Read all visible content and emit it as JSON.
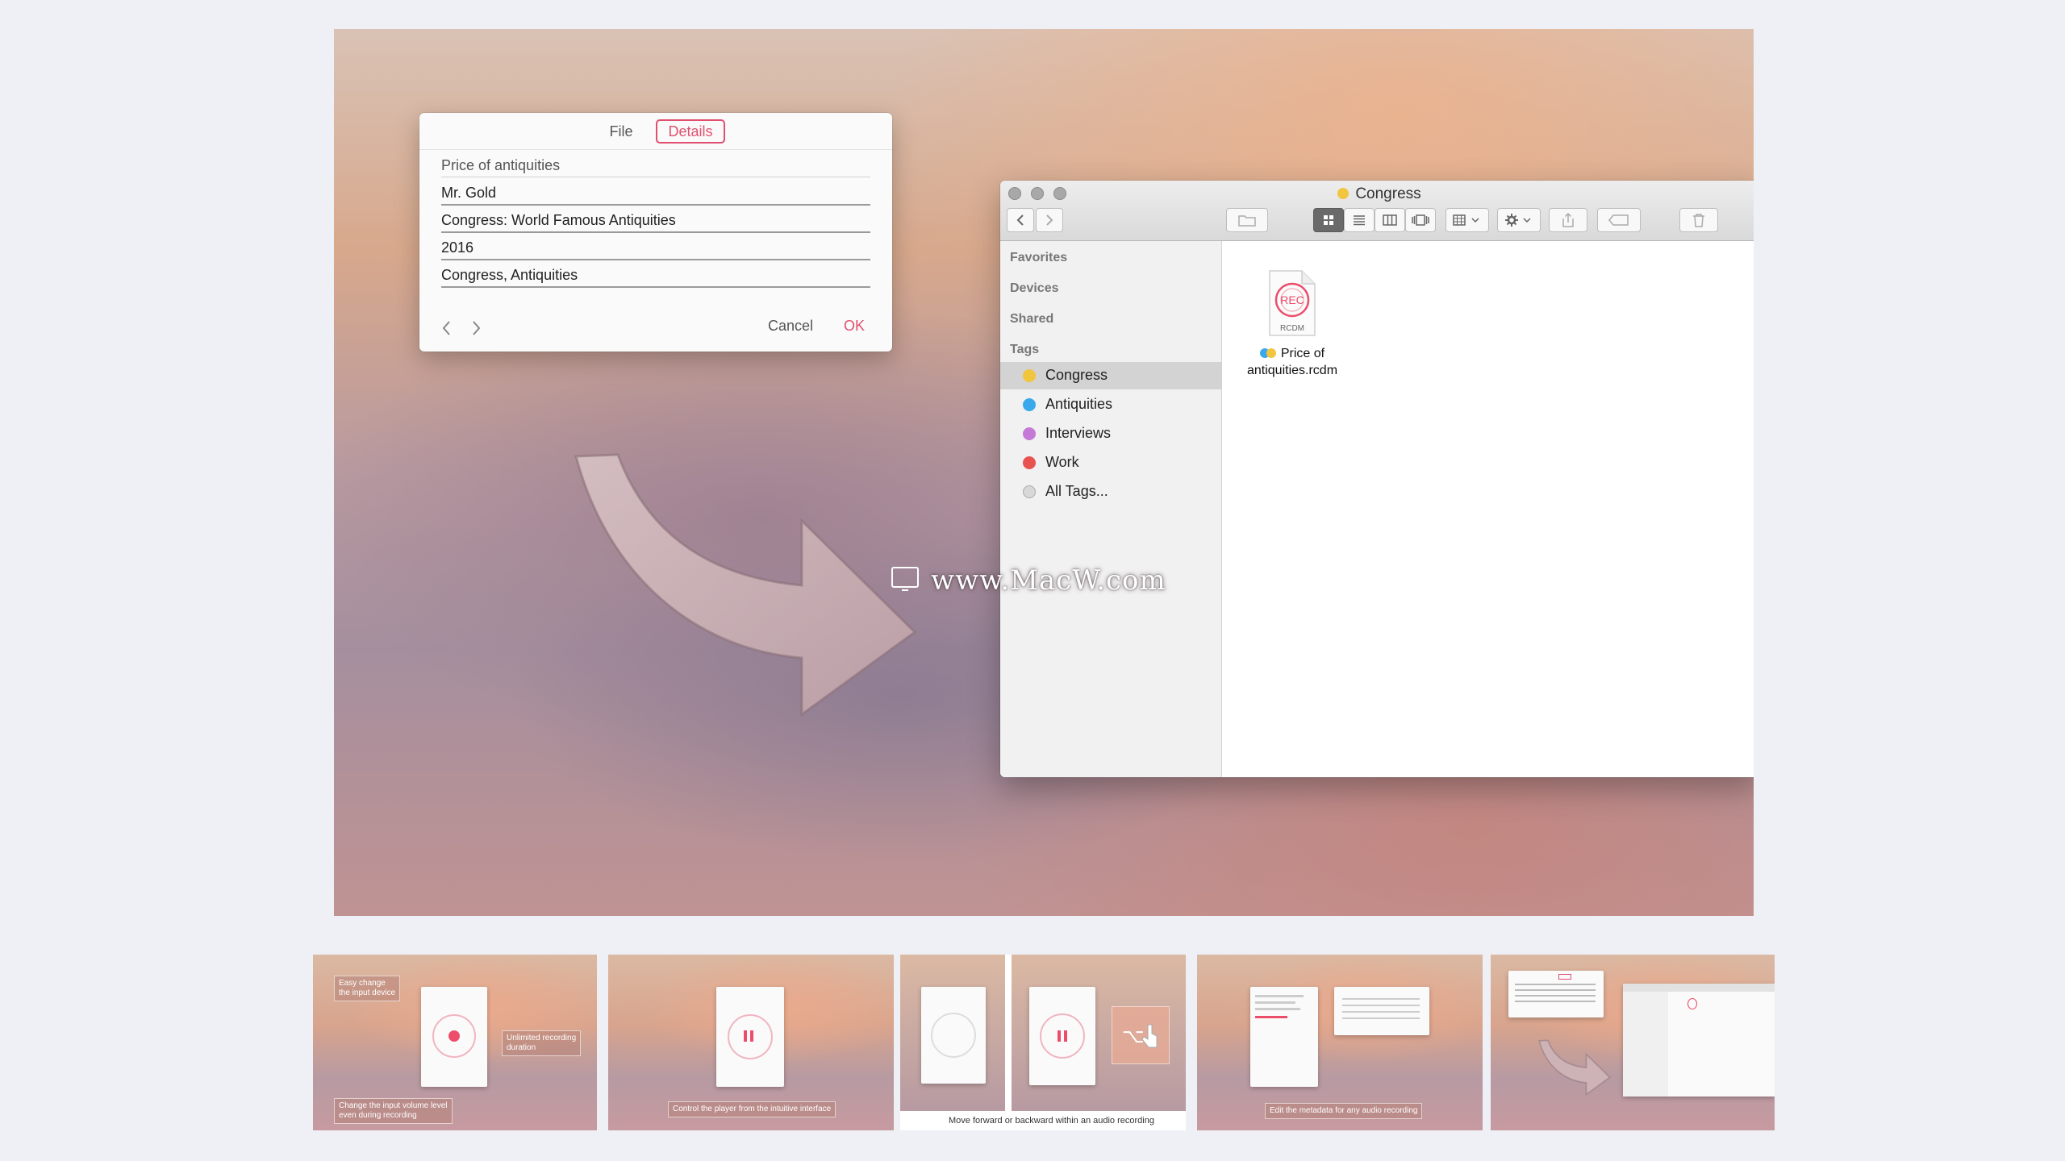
{
  "dialog": {
    "tabs": [
      "File",
      "Details"
    ],
    "fields": [
      "Price of antiquities",
      "Mr. Gold",
      "Congress: World Famous Antiquities",
      "2016",
      "Congress, Antiquities"
    ],
    "cancel": "Cancel",
    "ok": "OK"
  },
  "watermark": "www.MacW.com",
  "finder": {
    "title": "Congress",
    "sidebar": {
      "sections": [
        "Favorites",
        "Devices",
        "Shared",
        "Tags"
      ],
      "tags": [
        {
          "label": "Congress",
          "color": "#f2c53f"
        },
        {
          "label": "Antiquities",
          "color": "#3aa9ec"
        },
        {
          "label": "Interviews",
          "color": "#c47ad6"
        },
        {
          "label": "Work",
          "color": "#e8524f"
        },
        {
          "label": "All Tags...",
          "color": "#cfcfcf"
        }
      ]
    },
    "file": {
      "icon_text": "REC",
      "icon_sub": "RCDM",
      "name_line1": "Price of",
      "name_line2": "antiquities.rcdm"
    }
  },
  "thumbnails": {
    "t1": {
      "cap1": "Easy change\nthe input device",
      "cap2": "Unlimited recording\nduration",
      "cap3": "Change the input volume level\neven during recording"
    },
    "t2": {
      "cap": "Control the player from the intuitive interface"
    },
    "t3": {
      "cap": "Move forward or backward within an audio recording"
    },
    "t4": {
      "cap": "Edit the metadata for any audio recording"
    }
  },
  "colors": {
    "accent": "#e0506e",
    "record": "#ec4d6b"
  }
}
